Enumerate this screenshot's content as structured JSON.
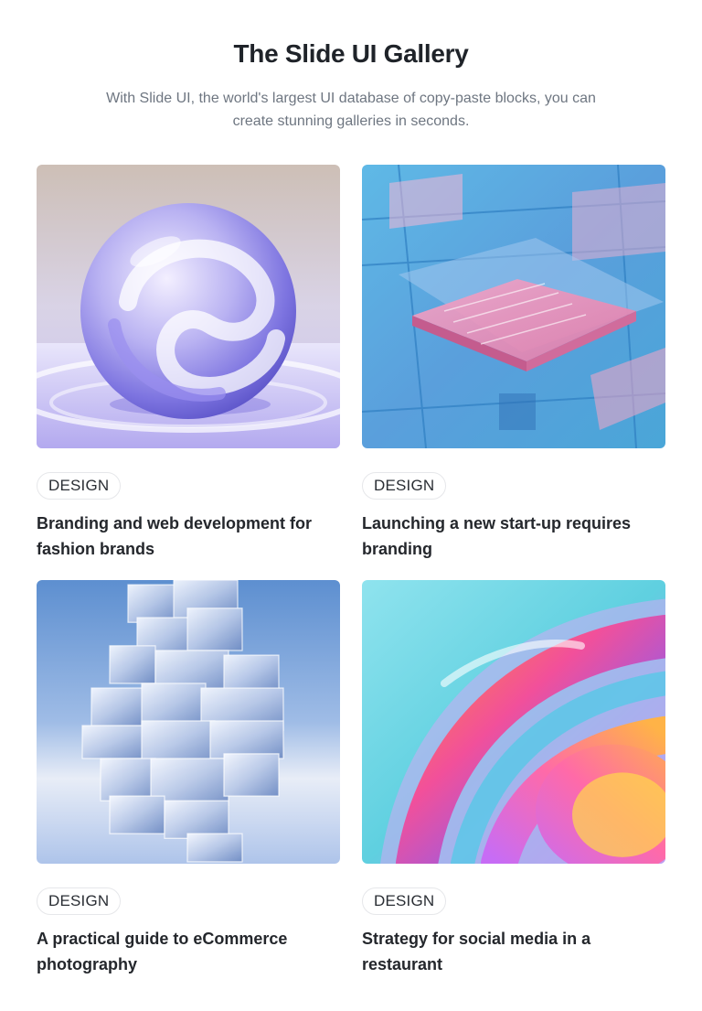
{
  "header": {
    "title": "The Slide UI Gallery",
    "subtitle": "With Slide UI, the world's largest UI database of copy-paste blocks, you can create stunning galleries in seconds."
  },
  "cards": [
    {
      "tag": "DESIGN",
      "title": "Branding and web development for fashion brands",
      "image": "glass-sphere-image"
    },
    {
      "tag": "DESIGN",
      "title": "Launching a new start-up requires branding",
      "image": "circuit-chip-image"
    },
    {
      "tag": "DESIGN",
      "title": "A practical guide to eCommerce photography",
      "image": "glass-cubes-tower-image"
    },
    {
      "tag": "DESIGN",
      "title": "Strategy for social media in a restaurant",
      "image": "iridescent-swirl-image"
    }
  ]
}
